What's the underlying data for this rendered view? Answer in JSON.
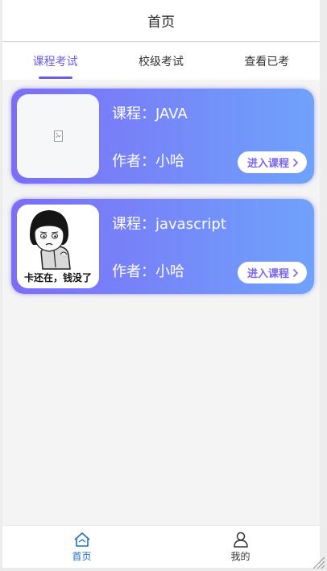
{
  "navbar": {
    "title": "首页"
  },
  "tabs": [
    {
      "label": "课程考试",
      "active": true
    },
    {
      "label": "校级考试",
      "active": false
    },
    {
      "label": "查看已考",
      "active": false
    }
  ],
  "courses": [
    {
      "title": "课程：JAVA",
      "author": "作者：小哈",
      "enter_label": "进入课程",
      "thumb": "broken-image"
    },
    {
      "title": "课程：javascript",
      "author": "作者：小哈",
      "enter_label": "进入课程",
      "thumb": "meme-image",
      "thumb_caption": "卡还在，钱没了"
    }
  ],
  "tabbar": [
    {
      "label": "首页",
      "icon": "home-icon",
      "active": true
    },
    {
      "label": "我的",
      "icon": "user-icon",
      "active": false
    }
  ],
  "colors": {
    "accent": "#6a5be6",
    "card_gradient_start": "#7d6df6",
    "card_gradient_end": "#6fa2fb",
    "tabbar_active": "#1f6fc2"
  }
}
